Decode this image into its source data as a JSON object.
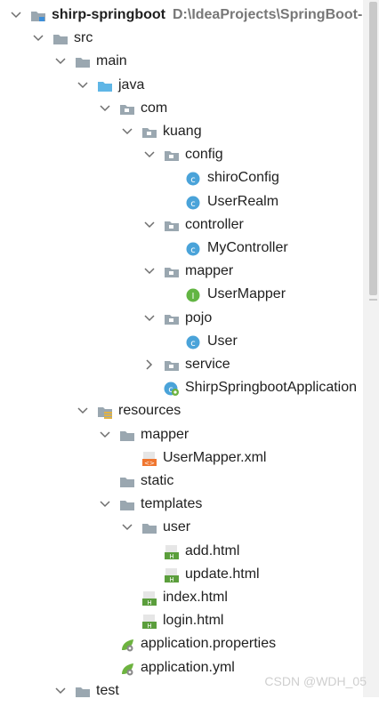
{
  "tree": [
    {
      "label": "shirp-springboot",
      "path": "D:\\IdeaProjects\\SpringBoot-cou",
      "icon": "module-folder-icon",
      "depth": 0,
      "expanded": true,
      "bold": true
    },
    {
      "label": "src",
      "icon": "folder-icon",
      "depth": 1,
      "expanded": true
    },
    {
      "label": "main",
      "icon": "folder-icon",
      "depth": 2,
      "expanded": true
    },
    {
      "label": "java",
      "icon": "source-folder-icon",
      "depth": 3,
      "expanded": true
    },
    {
      "label": "com",
      "icon": "package-icon",
      "depth": 4,
      "expanded": true
    },
    {
      "label": "kuang",
      "icon": "package-icon",
      "depth": 5,
      "expanded": true
    },
    {
      "label": "config",
      "icon": "package-icon",
      "depth": 6,
      "expanded": true
    },
    {
      "label": "shiroConfig",
      "icon": "class-icon",
      "depth": 7
    },
    {
      "label": "UserRealm",
      "icon": "class-icon",
      "depth": 7
    },
    {
      "label": "controller",
      "icon": "package-icon",
      "depth": 6,
      "expanded": true
    },
    {
      "label": "MyController",
      "icon": "class-icon",
      "depth": 7
    },
    {
      "label": "mapper",
      "icon": "package-icon",
      "depth": 6,
      "expanded": true
    },
    {
      "label": "UserMapper",
      "icon": "interface-icon",
      "depth": 7
    },
    {
      "label": "pojo",
      "icon": "package-icon",
      "depth": 6,
      "expanded": true
    },
    {
      "label": "User",
      "icon": "class-icon",
      "depth": 7
    },
    {
      "label": "service",
      "icon": "package-icon",
      "depth": 6,
      "expanded": false
    },
    {
      "label": "ShirpSpringbootApplication",
      "icon": "spring-boot-class-icon",
      "depth": 6
    },
    {
      "label": "resources",
      "icon": "resources-folder-icon",
      "depth": 3,
      "expanded": true
    },
    {
      "label": "mapper",
      "icon": "folder-icon",
      "depth": 4,
      "expanded": true
    },
    {
      "label": "UserMapper.xml",
      "icon": "xml-file-icon",
      "depth": 5
    },
    {
      "label": "static",
      "icon": "folder-icon",
      "depth": 4
    },
    {
      "label": "templates",
      "icon": "folder-icon",
      "depth": 4,
      "expanded": true
    },
    {
      "label": "user",
      "icon": "folder-icon",
      "depth": 5,
      "expanded": true
    },
    {
      "label": "add.html",
      "icon": "html-file-icon",
      "depth": 6
    },
    {
      "label": "update.html",
      "icon": "html-file-icon",
      "depth": 6
    },
    {
      "label": "index.html",
      "icon": "html-file-icon",
      "depth": 5
    },
    {
      "label": "login.html",
      "icon": "html-file-icon",
      "depth": 5
    },
    {
      "label": "application.properties",
      "icon": "spring-config-file-icon",
      "depth": 4
    },
    {
      "label": "application.yml",
      "icon": "spring-config-file-icon",
      "depth": 4
    },
    {
      "label": "test",
      "icon": "folder-icon",
      "depth": 2,
      "expanded": true
    }
  ],
  "watermark": "CSDN @WDH_05",
  "colors": {
    "folder": "#9aa7b0",
    "source_folder": "#5fb6e6",
    "class": "#4aa3d9",
    "interface": "#62b543",
    "xml": "#f0762f",
    "html": "#5b9e3c",
    "spring": "#6db33f"
  }
}
